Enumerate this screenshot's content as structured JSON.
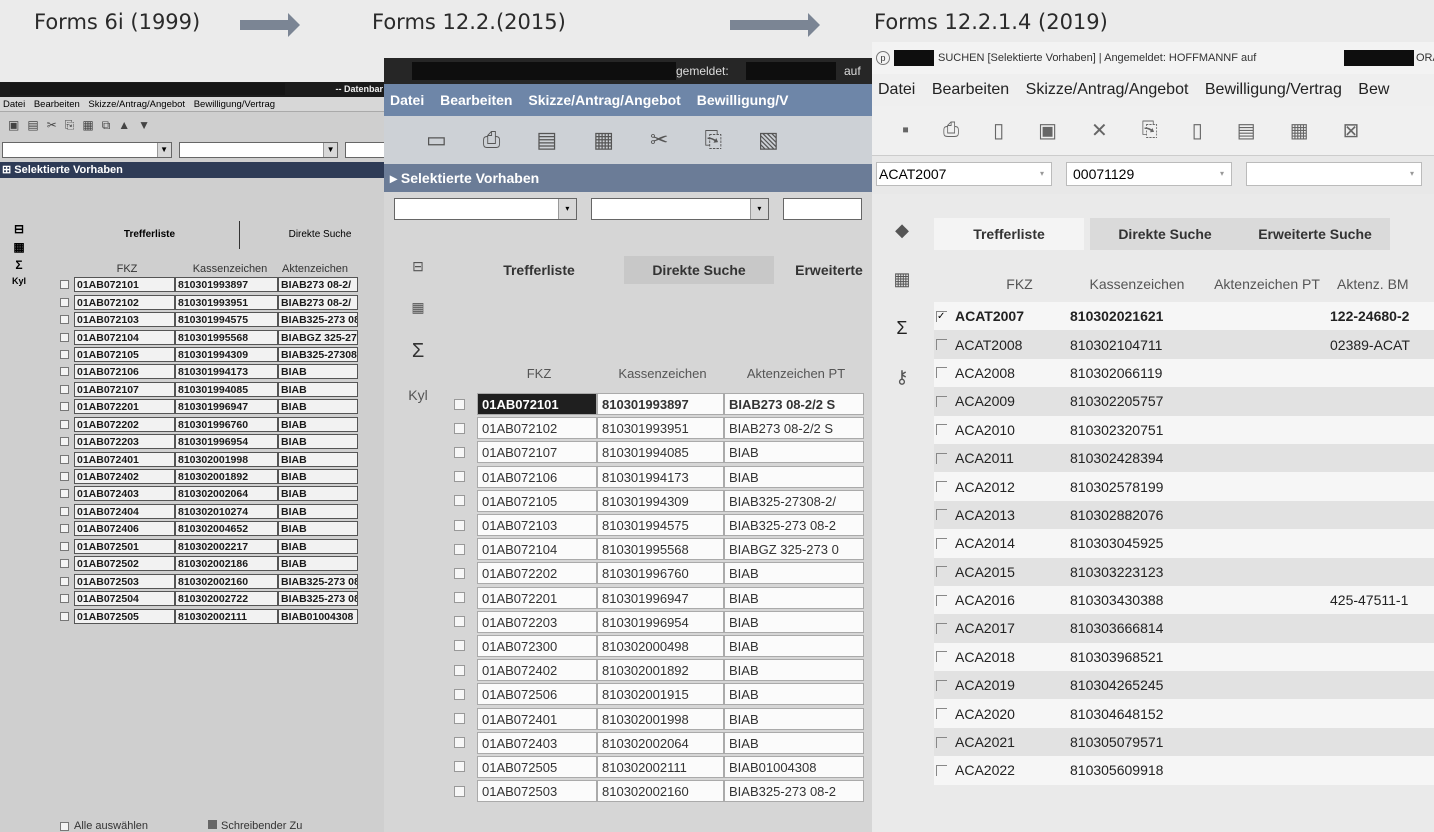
{
  "captions": [
    "Forms 6i (1999)",
    "Forms 12.2.(2015)",
    "Forms 12.2.1.4 (2019)"
  ],
  "w1": {
    "title": "-- Datenbar",
    "menu": [
      "Datei",
      "Bearbeiten",
      "Skizze/Antrag/Angebot",
      "Bewilligung/Vertrag"
    ],
    "section_title": "Selektierte Vorhaben",
    "side": [
      "Σ",
      "Kyl"
    ],
    "tabs": [
      "Trefferliste",
      "Direkte Suche"
    ],
    "headers": [
      "FKZ",
      "Kassenzeichen",
      "Aktenzeichen"
    ],
    "rows": [
      [
        "01AB072101",
        "810301993897",
        "BIAB273 08-2/"
      ],
      [
        "01AB072102",
        "810301993951",
        "BIAB273 08-2/"
      ],
      [
        "01AB072103",
        "810301994575",
        "BIAB325-273 08"
      ],
      [
        "01AB072104",
        "810301995568",
        "BIABGZ 325-27"
      ],
      [
        "01AB072105",
        "810301994309",
        "BIAB325-27308"
      ],
      [
        "01AB072106",
        "810301994173",
        "BIAB"
      ],
      [
        "01AB072107",
        "810301994085",
        "BIAB"
      ],
      [
        "01AB072201",
        "810301996947",
        "BIAB"
      ],
      [
        "01AB072202",
        "810301996760",
        "BIAB"
      ],
      [
        "01AB072203",
        "810301996954",
        "BIAB"
      ],
      [
        "01AB072401",
        "810302001998",
        "BIAB"
      ],
      [
        "01AB072402",
        "810302001892",
        "BIAB"
      ],
      [
        "01AB072403",
        "810302002064",
        "BIAB"
      ],
      [
        "01AB072404",
        "810302010274",
        "BIAB"
      ],
      [
        "01AB072406",
        "810302004652",
        "BIAB"
      ],
      [
        "01AB072501",
        "810302002217",
        "BIAB"
      ],
      [
        "01AB072502",
        "810302002186",
        "BIAB"
      ],
      [
        "01AB072503",
        "810302002160",
        "BIAB325-273 08"
      ],
      [
        "01AB072504",
        "810302002722",
        "BIAB325-273 08"
      ],
      [
        "01AB072505",
        "810302002111",
        "BIAB01004308"
      ]
    ],
    "select_all": "Alle auswählen",
    "legend": "Schreibender Zu"
  },
  "w2": {
    "title": "gemeldet:",
    "title_suffix": "auf",
    "menu": [
      "Datei",
      "Bearbeiten",
      "Skizze/Antrag/Angebot",
      "Bewilligung/V"
    ],
    "section_title": "Selektierte Vorhaben",
    "side": [
      "Σ",
      "Kyl"
    ],
    "tabs": [
      "Trefferliste",
      "Direkte Suche",
      "Erweiterte"
    ],
    "headers": [
      "FKZ",
      "Kassenzeichen",
      "Aktenzeichen PT"
    ],
    "rows": [
      [
        "01AB072101",
        "810301993897",
        "BIAB273 08-2/2 S"
      ],
      [
        "01AB072102",
        "810301993951",
        "BIAB273 08-2/2 S"
      ],
      [
        "01AB072107",
        "810301994085",
        "BIAB"
      ],
      [
        "01AB072106",
        "810301994173",
        "BIAB"
      ],
      [
        "01AB072105",
        "810301994309",
        "BIAB325-27308-2/"
      ],
      [
        "01AB072103",
        "810301994575",
        "BIAB325-273 08-2"
      ],
      [
        "01AB072104",
        "810301995568",
        "BIABGZ 325-273 0"
      ],
      [
        "01AB072202",
        "810301996760",
        "BIAB"
      ],
      [
        "01AB072201",
        "810301996947",
        "BIAB"
      ],
      [
        "01AB072203",
        "810301996954",
        "BIAB"
      ],
      [
        "01AB072300",
        "810302000498",
        "BIAB"
      ],
      [
        "01AB072402",
        "810302001892",
        "BIAB"
      ],
      [
        "01AB072506",
        "810302001915",
        "BIAB"
      ],
      [
        "01AB072401",
        "810302001998",
        "BIAB"
      ],
      [
        "01AB072403",
        "810302002064",
        "BIAB"
      ],
      [
        "01AB072505",
        "810302002111",
        "BIAB01004308"
      ],
      [
        "01AB072503",
        "810302002160",
        "BIAB325-273 08-2"
      ]
    ]
  },
  "w3": {
    "title": "SUCHEN [Selektierte Vorhaben] | Angemeldet: HOFFMANNF auf",
    "title_suffix": "ORA",
    "menu": [
      "Datei",
      "Bearbeiten",
      "Skizze/Antrag/Angebot",
      "Bewilligung/Vertrag",
      "Bew"
    ],
    "combo_values": [
      "ACAT2007",
      "00071129",
      ""
    ],
    "side": [
      "Σ"
    ],
    "tabs": [
      "Trefferliste",
      "Direkte Suche",
      "Erweiterte Suche"
    ],
    "headers": [
      "FKZ",
      "Kassenzeichen",
      "Aktenzeichen PT",
      "Aktenz. BM"
    ],
    "rows": [
      [
        "ACAT2007",
        "810302021621",
        "",
        "122-24680-2"
      ],
      [
        "ACAT2008",
        "810302104711",
        "",
        "02389-ACAT"
      ],
      [
        "ACA2008",
        "810302066119",
        "",
        ""
      ],
      [
        "ACA2009",
        "810302205757",
        "",
        ""
      ],
      [
        "ACA2010",
        "810302320751",
        "",
        ""
      ],
      [
        "ACA2011",
        "810302428394",
        "",
        ""
      ],
      [
        "ACA2012",
        "810302578199",
        "",
        ""
      ],
      [
        "ACA2013",
        "810302882076",
        "",
        ""
      ],
      [
        "ACA2014",
        "810303045925",
        "",
        ""
      ],
      [
        "ACA2015",
        "810303223123",
        "",
        ""
      ],
      [
        "ACA2016",
        "810303430388",
        "",
        "425-47511-1"
      ],
      [
        "ACA2017",
        "810303666814",
        "",
        ""
      ],
      [
        "ACA2018",
        "810303968521",
        "",
        ""
      ],
      [
        "ACA2019",
        "810304265245",
        "",
        ""
      ],
      [
        "ACA2020",
        "810304648152",
        "",
        ""
      ],
      [
        "ACA2021",
        "810305079571",
        "",
        ""
      ],
      [
        "ACA2022",
        "810305609918",
        "",
        ""
      ]
    ]
  }
}
